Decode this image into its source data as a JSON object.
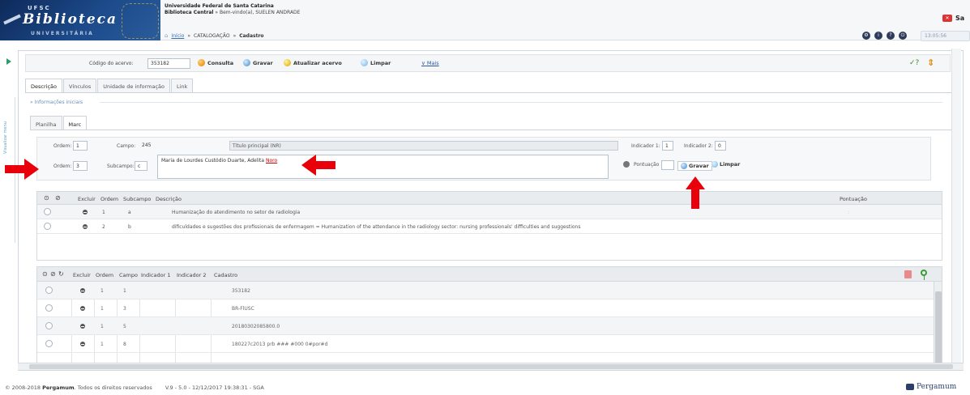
{
  "header": {
    "logo": {
      "top": "UFSC",
      "main": "Biblioteca",
      "bottom": "UNIVERSITÁRIA"
    },
    "institution": "Universidade Federal de Santa Catarina",
    "library": "Biblioteca Central",
    "welcome": "» Bem-vindo(a), SUELEN ANDRADE",
    "breadcrumb": {
      "home": "Início",
      "sep": "»",
      "section": "CATALOGAÇÃO",
      "page": "Cadastro"
    },
    "exit_label": "Sa",
    "clock": "13:05:56"
  },
  "rail": {
    "label": "Visualizar menu"
  },
  "toolbar": {
    "acervo_label": "Código do acervo:",
    "acervo_value": "353182",
    "consulta": "Consulta",
    "gravar": "Gravar",
    "atualizar": "Atualizar acervo",
    "limpar": "Limpar",
    "mais": "Mais",
    "mais_caret": "∨",
    "check_icon": "✓?",
    "sort_icon": "⇕"
  },
  "tabs": [
    "Descrição",
    "Vínculos",
    "Unidade de informação",
    "Link"
  ],
  "info_label": "» Informações iniciais",
  "subtabs": [
    "Planilha",
    "Marc"
  ],
  "form": {
    "ordem_label": "Ordem:",
    "ordem_value": "1",
    "campo_label": "Campo:",
    "campo_value": "245",
    "campo_desc": "Título principal (NR)",
    "ind1_label": "Indicador 1:",
    "ind1_value": "1",
    "ind2_label": "Indicador 2:",
    "ind2_value": "0",
    "ordem2_label": "Ordem:",
    "ordem2_value": "3",
    "subcampo_label": "Subcampo:",
    "subcampo_value": "c",
    "value_text": "Maria de Lourdes Custódio Duarte, Adelita ",
    "value_underline": "Noro",
    "pontuacao_label": "Pontuação",
    "gravar": "Gravar",
    "limpar": "Limpar"
  },
  "subfields_table": {
    "columns": [
      "Excluir",
      "Ordem",
      "Subcampo",
      "Descrição",
      "Pontuação"
    ],
    "rows": [
      {
        "ordem": "1",
        "subcampo": "a",
        "descricao": "Humanização do atendimento no setor de radiologia",
        "pontuacao": ":"
      },
      {
        "ordem": "2",
        "subcampo": "b",
        "descricao": "dificuldades e sugestões dos profissionais de enfermagem = Humanization of the attendance in the radiology sector: nursing professionals' difficulties and suggestions",
        "pontuacao": ""
      }
    ]
  },
  "fields_table": {
    "columns": [
      "Excluir",
      "Ordem",
      "Campo",
      "Indicador 1",
      "Indicador 2",
      "Cadastro"
    ],
    "rows": [
      {
        "ordem": "1",
        "campo": "1",
        "ind1": "",
        "ind2": "",
        "cadastro": "353182"
      },
      {
        "ordem": "1",
        "campo": "3",
        "ind1": "",
        "ind2": "",
        "cadastro": "BR-FlUSC"
      },
      {
        "ordem": "1",
        "campo": "5",
        "ind1": "",
        "ind2": "",
        "cadastro": "20180302085800.0"
      },
      {
        "ordem": "1",
        "campo": "8",
        "ind1": "",
        "ind2": "",
        "cadastro": "180227c2013 prb ### #000 0#por#d"
      }
    ]
  },
  "footer": {
    "copyright_prefix": "© 2008-2018",
    "brand": "Pergamum",
    "copyright_suffix": ". Todos os direitos reservados",
    "version": "V.9 - 5.0 - 12/12/2017 19:38:31 - SGA",
    "logo_text": "Pergamum"
  },
  "colors": {
    "accent": "#3a6ab0",
    "arrow": "#e8000a",
    "header_bg": "#f6f7f9"
  }
}
